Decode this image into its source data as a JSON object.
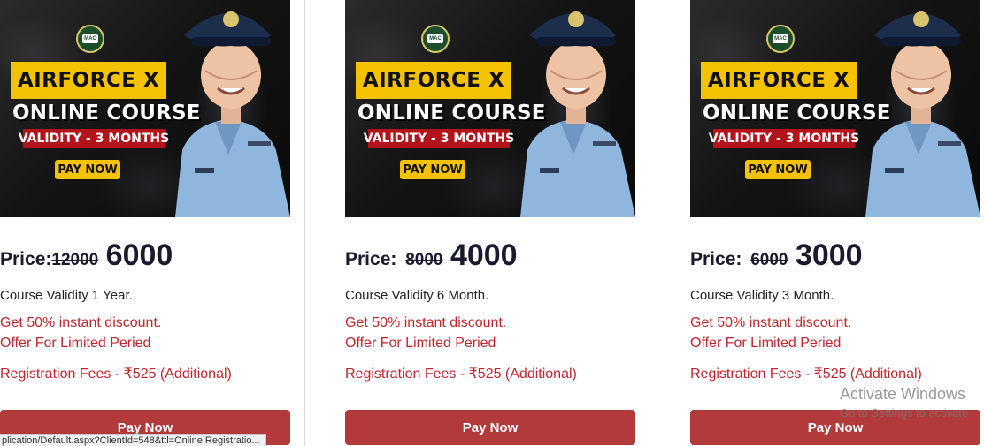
{
  "banner": {
    "logo_text": "MAC",
    "course_tag": "AIRFORCE X",
    "course_title": "ONLINE COURSE",
    "validity_tag": "VALIDITY - 3 MONTHS",
    "pay_tag": "PAY NOW"
  },
  "cards": [
    {
      "price_label": "Price:",
      "old_price": "12000",
      "new_price": "6000",
      "validity": "Course Validity 1 Year.",
      "discount": "Get 50% instant discount.",
      "offer": "Offer For Limited Peried",
      "registration": "Registration Fees - ₹525 (Additional)",
      "button": "Pay Now"
    },
    {
      "price_label": "Price: ",
      "old_price": "8000",
      "new_price": "4000",
      "validity": "Course Validity 6 Month.",
      "discount": "Get 50% instant discount.",
      "offer": "Offer For Limited Peried",
      "registration": "Registration Fees - ₹525 (Additional)",
      "button": "Pay Now"
    },
    {
      "price_label": "Price: ",
      "old_price": "6000",
      "new_price": "3000",
      "validity": "Course Validity 3 Month.",
      "discount": "Get 50% instant discount.",
      "offer": "Offer For Limited Peried",
      "registration": "Registration Fees - ₹525 (Additional)",
      "button": "Pay Now"
    }
  ],
  "status_bar": {
    "url": "plication/Default.aspx?ClientId=548&ttl=Online Registratio..."
  },
  "windows_watermark": {
    "line1": "Activate Windows",
    "line2": "Go to Settings to activate"
  },
  "colors": {
    "accent_red": "#c0272d",
    "button_red": "#b33a3a",
    "banner_yellow": "#f4c200",
    "price_dark": "#1a1a2e"
  }
}
